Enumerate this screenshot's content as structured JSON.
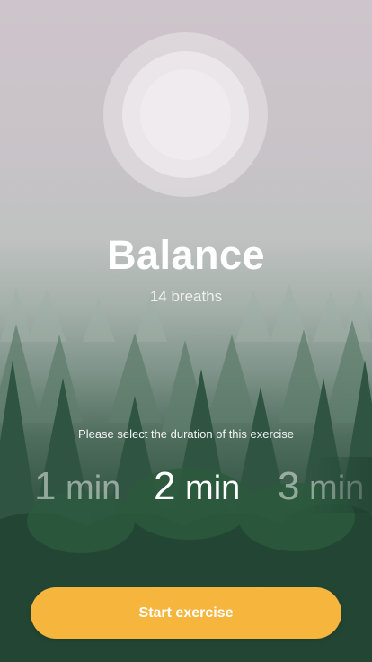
{
  "exercise": {
    "title": "Balance",
    "subtitle": "14 breaths"
  },
  "duration": {
    "prompt": "Please select the duration of this exercise",
    "options": [
      {
        "value": "1",
        "unit": "min",
        "selected": false
      },
      {
        "value": "2",
        "unit": "min",
        "selected": true
      },
      {
        "value": "3",
        "unit": "min",
        "selected": false
      }
    ]
  },
  "actions": {
    "start_label": "Start exercise"
  },
  "colors": {
    "accent": "#f6b63e",
    "text_primary": "#ffffff",
    "circle": "#efebee",
    "sky": "#cdc5cb",
    "forest_dark": "#1f3f2f"
  }
}
